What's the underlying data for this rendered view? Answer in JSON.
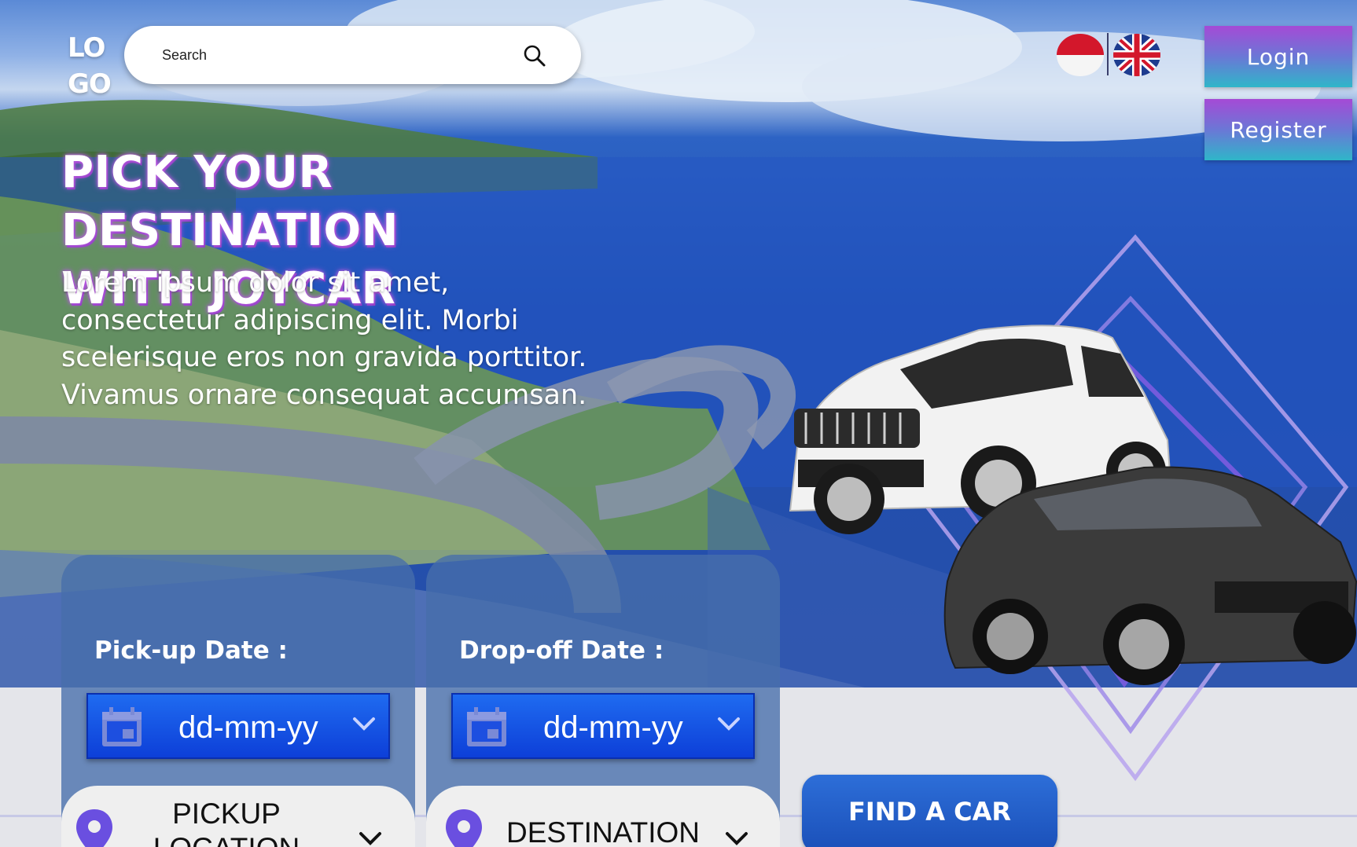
{
  "header": {
    "logo_line1": "LO",
    "logo_line2": "GO",
    "search_placeholder": "Search",
    "languages": [
      "Indonesian",
      "English"
    ],
    "login_label": "Login",
    "register_label": "Register"
  },
  "hero": {
    "title_line1": "PICK YOUR DESTINATION",
    "title_line2": "WITH JOYCAR",
    "description": "Lorem ipsum dolor sit amet, consectetur adipiscing elit. Morbi scelerisque eros non gravida porttitor. Vivamus ornare consequat accumsan."
  },
  "booking": {
    "pickup": {
      "label": "Pick-up Date :",
      "date_value": "dd-mm-yy",
      "location_line1": "PICKUP",
      "location_line2": "LOCATION"
    },
    "dropoff": {
      "label": "Drop-off Date :",
      "date_value": "dd-mm-yy",
      "location_line1": "DESTINATION"
    },
    "find_button": "FIND A CAR"
  },
  "colors": {
    "accent_gradient_top": "#a54ad6",
    "accent_gradient_bottom": "#2fb6c9",
    "date_select_blue": "#0d3fd8",
    "pin_purple": "#6a4fe0",
    "find_button_blue": "#1a4fb8"
  },
  "icons": [
    "search-icon",
    "calendar-icon",
    "chevron-down-icon",
    "location-pin-icon",
    "flag-indonesia-icon",
    "flag-uk-icon"
  ]
}
